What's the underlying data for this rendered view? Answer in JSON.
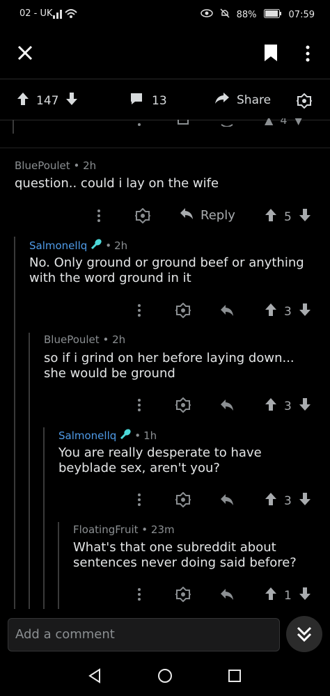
{
  "status": {
    "carrier": "02 - UK",
    "battery": "88%",
    "time": "07:59"
  },
  "post": {
    "upvotes": "147",
    "comments": "13",
    "share_label": "Share"
  },
  "comments": [
    {
      "author": "BluePoulet",
      "time": "2h",
      "body": "question.. could i lay on the wife",
      "votes": "5",
      "reply_label": "Reply"
    },
    {
      "author": "Salmonellq",
      "time": "2h",
      "body": "No. Only ground or ground beef or anything with the word ground in it",
      "votes": "3"
    },
    {
      "author": "BluePoulet",
      "time": "2h",
      "body": "so if i grind on her before laying down... she would be ground",
      "votes": "3"
    },
    {
      "author": "Salmonellq",
      "time": "1h",
      "body": "You are really desperate to have beyblade sex, aren't you?",
      "votes": "3"
    },
    {
      "author": "FloatingFruit",
      "time": "23m",
      "body": "What's that one subreddit about sentences never doing said before?",
      "votes": "1"
    }
  ],
  "partial": {
    "votes": "4"
  },
  "composer": {
    "placeholder": "Add a comment"
  },
  "colors": {
    "background": "#000000",
    "author_highlight": "#4f9be8",
    "text": "#e4e6e7",
    "muted": "#8b8f92"
  },
  "icons": [
    "close-icon",
    "bookmark-icon",
    "more-vertical-icon",
    "upvote-icon",
    "downvote-icon",
    "comment-icon",
    "share-icon",
    "award-icon",
    "reply-icon",
    "moderator-brush-icon",
    "collapse-down-icon",
    "nav-back-icon",
    "nav-home-icon",
    "nav-recents-icon"
  ]
}
